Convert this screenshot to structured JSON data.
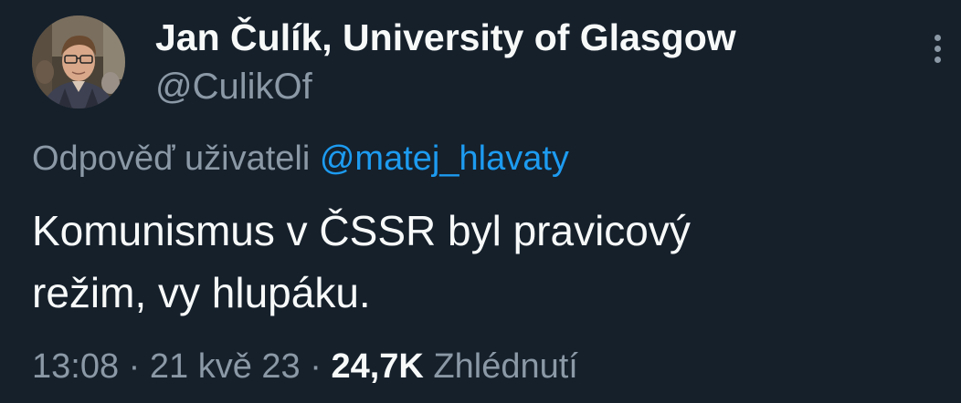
{
  "author": {
    "display_name": "Jan Čulík, University of Glasgow",
    "handle": "@CulikOf",
    "avatar_icon": "profile-photo"
  },
  "reply": {
    "prefix": "Odpověď uživateli",
    "mention": "@matej_hlavaty"
  },
  "tweet": {
    "text": "Komunismus v ČSSR byl pravicový\nrežim, vy hlupáku."
  },
  "meta": {
    "time": "13:08",
    "separator": "·",
    "date": "21 kvě 23",
    "views_count": "24,7K",
    "views_label": "Zhlédnutí"
  },
  "more_icon": "more-vertical-icon",
  "colors": {
    "background": "#15202b",
    "primary_text": "#f7f9f9",
    "secondary_text": "#8b98a5",
    "link": "#1d9bf0"
  }
}
